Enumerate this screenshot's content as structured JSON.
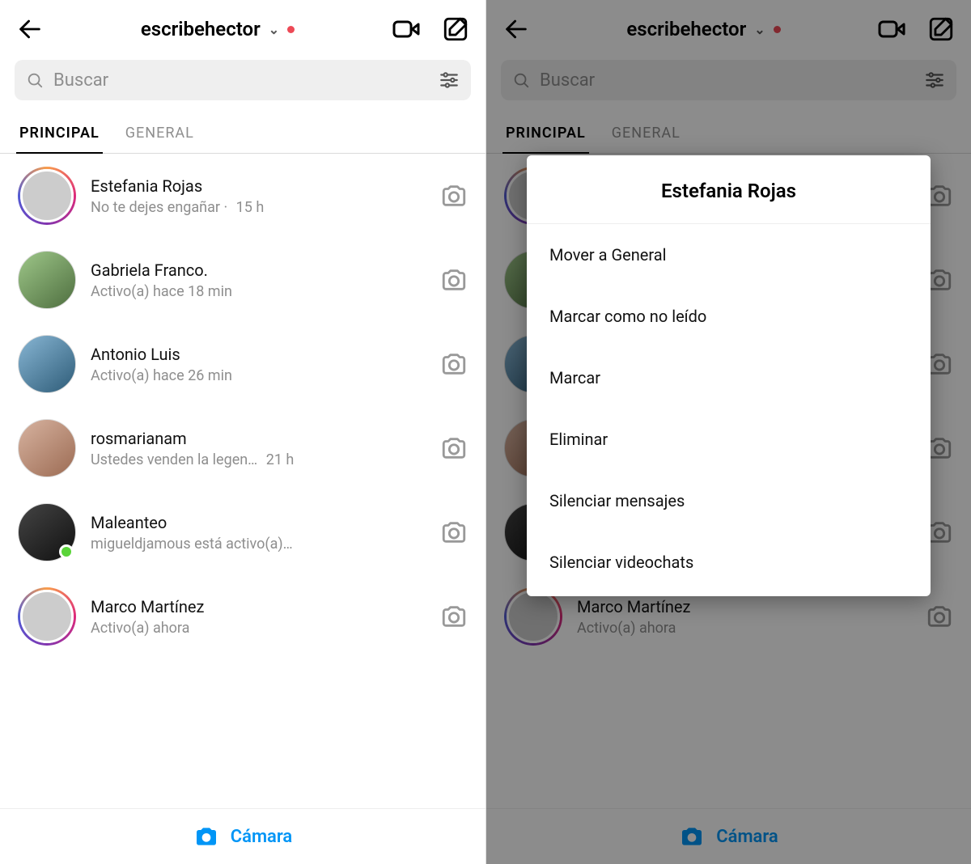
{
  "header": {
    "username": "escribehector"
  },
  "search": {
    "placeholder": "Buscar"
  },
  "tabs": {
    "principal": "PRINCIPAL",
    "general": "GENERAL"
  },
  "chats": [
    {
      "name": "Estefania Rojas",
      "subtitle": "No te dejes engañar",
      "time": "15 h",
      "story": true,
      "presence": false
    },
    {
      "name": "Gabriela Franco.",
      "subtitle": "Activo(a) hace 18 min",
      "time": "",
      "story": false,
      "presence": false
    },
    {
      "name": "Antonio Luis",
      "subtitle": "Activo(a) hace 26 min",
      "time": "",
      "story": false,
      "presence": false
    },
    {
      "name": "rosmarianam",
      "subtitle": "Ustedes venden la legen…",
      "time": "21 h",
      "story": false,
      "presence": false
    },
    {
      "name": "Maleanteo",
      "subtitle": "migueldjamous está activo(a)…",
      "time": "",
      "story": false,
      "presence": true
    },
    {
      "name": "Marco Martínez",
      "subtitle": "Activo(a) ahora",
      "time": "",
      "story": true,
      "presence": false
    }
  ],
  "bottom": {
    "camera": "Cámara"
  },
  "sheet": {
    "title": "Estefania Rojas",
    "options": [
      "Mover a General",
      "Marcar como no leído",
      "Marcar",
      "Eliminar",
      "Silenciar mensajes",
      "Silenciar videochats"
    ]
  }
}
